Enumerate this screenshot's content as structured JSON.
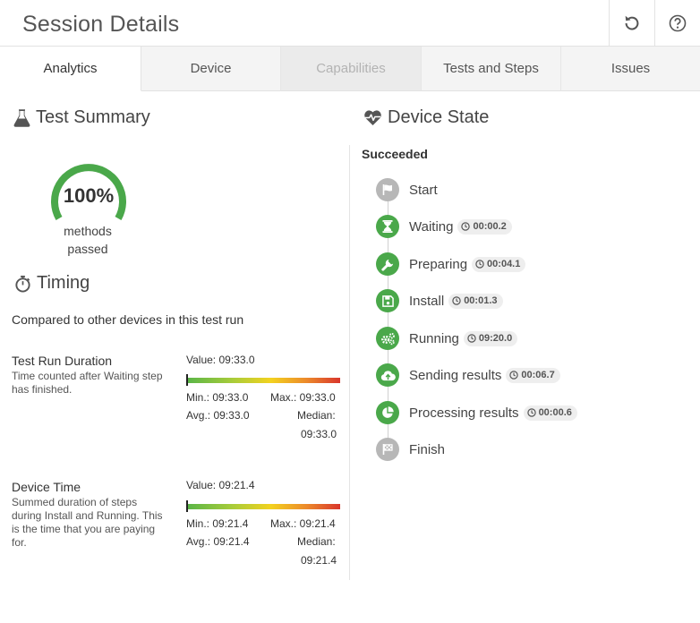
{
  "header": {
    "title": "Session Details",
    "refresh_icon": "refresh-icon",
    "help_icon": "help-icon"
  },
  "tabs": [
    {
      "label": "Analytics",
      "state": "active"
    },
    {
      "label": "Device",
      "state": "normal"
    },
    {
      "label": "Capabilities",
      "state": "disabled"
    },
    {
      "label": "Tests and Steps",
      "state": "normal"
    },
    {
      "label": "Issues",
      "state": "normal"
    }
  ],
  "test_summary": {
    "title": "Test Summary",
    "icon": "flask-icon",
    "percent": "100%",
    "percent_value": 100,
    "label": "methods passed",
    "accent_color": "#4aa84a"
  },
  "timing": {
    "title": "Timing",
    "icon": "stopwatch-icon",
    "compare_text": "Compared to other devices in this test run",
    "metrics": [
      {
        "title": "Test Run Duration",
        "description": "Time counted after Waiting step has finished.",
        "value": "Value: 09:33.0",
        "min": "Min.: 09:33.0",
        "max": "Max.: 09:33.0",
        "avg": "Avg.: 09:33.0",
        "median_label": "Median:",
        "median": "09:33.0",
        "position": 0
      },
      {
        "title": "Device Time",
        "description": "Summed duration of steps during Install and Running. This is the time that you are paying for.",
        "value": "Value: 09:21.4",
        "min": "Min.: 09:21.4",
        "max": "Max.: 09:21.4",
        "avg": "Avg.: 09:21.4",
        "median_label": "Median:",
        "median": "09:21.4",
        "position": 0
      }
    ]
  },
  "device_state": {
    "title": "Device State",
    "icon": "heartbeat-icon",
    "status": "Succeeded",
    "steps": [
      {
        "label": "Start",
        "duration": "",
        "icon": "flag-icon",
        "color": "grey"
      },
      {
        "label": "Waiting",
        "duration": "00:00.2",
        "icon": "hourglass-icon",
        "color": "green"
      },
      {
        "label": "Preparing",
        "duration": "00:04.1",
        "icon": "wrench-icon",
        "color": "green"
      },
      {
        "label": "Install",
        "duration": "00:01.3",
        "icon": "save-icon",
        "color": "green"
      },
      {
        "label": "Running",
        "duration": "09:20.0",
        "icon": "cogs-icon",
        "color": "green"
      },
      {
        "label": "Sending results",
        "duration": "00:06.7",
        "icon": "cloud-upload-icon",
        "color": "green"
      },
      {
        "label": "Processing results",
        "duration": "00:00.6",
        "icon": "pie-chart-icon",
        "color": "green"
      },
      {
        "label": "Finish",
        "duration": "",
        "icon": "checkered-flag-icon",
        "color": "grey"
      }
    ]
  }
}
